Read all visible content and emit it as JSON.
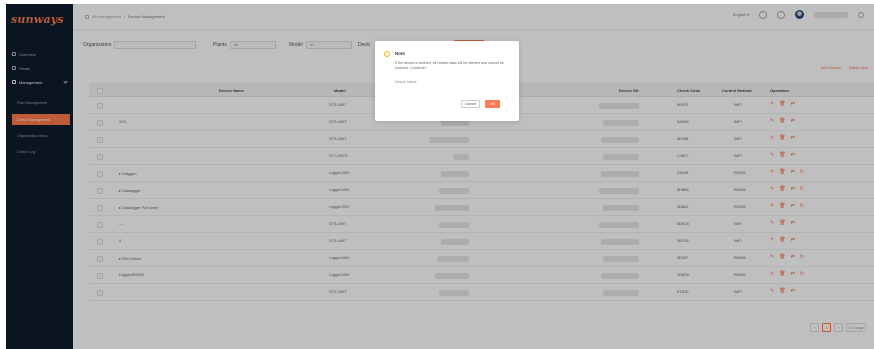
{
  "app": {
    "logo": "sunways"
  },
  "sidebar": {
    "items": [
      {
        "label": "Overview",
        "icon": "dashboard-icon"
      },
      {
        "label": "Plants",
        "icon": "plant-icon"
      },
      {
        "label": "Management",
        "icon": "management-icon"
      }
    ],
    "sub_items": [
      {
        "label": "Plant Management"
      },
      {
        "label": "Device Management"
      },
      {
        "label": "Organization Mana..."
      },
      {
        "label": "Device Log"
      }
    ]
  },
  "topbar": {
    "breadcrumb": [
      "All management",
      "Device Management"
    ],
    "language": "English ▾"
  },
  "filters": {
    "organization_label": "Organization",
    "plants_label": "Plants",
    "plants_value": "All",
    "model_label": "Model",
    "model_value": "All",
    "device_label": "Devic"
  },
  "actions": {
    "add": "Add Device",
    "batch": "Batch dele"
  },
  "table": {
    "headers": [
      "Device Name",
      "Model",
      "Device SN",
      "Check Code",
      "Control Method",
      "Operation"
    ],
    "rows": [
      {
        "name": "",
        "model": "STS-40KT",
        "code": "8E47E",
        "method": "WiFi",
        "ops": 3
      },
      {
        "name": "WTL",
        "model": "STS-40KT",
        "code": "9A8D5",
        "method": "WiFi",
        "ops": 3
      },
      {
        "name": "",
        "model": "STS-40KT",
        "code": "8E40B",
        "method": "WiFi",
        "ops": 3
      },
      {
        "name": "",
        "model": "STT-25KTL",
        "code": "C4B17",
        "method": "WiFi",
        "ops": 3
      },
      {
        "name": "▸ Draggan",
        "model": "Logger1000",
        "code": "41B2B",
        "method": "RS485",
        "ops": 4
      },
      {
        "name": "▸ Datalogger",
        "model": "Logger1000",
        "code": "6H8B5",
        "method": "RS485",
        "ops": 4
      },
      {
        "name": "▸ Datalogger Port Amer",
        "model": "Logger1000",
        "code": "3D8A1",
        "method": "RS485",
        "ops": 4
      },
      {
        "name": "—",
        "model": "STS-40KT",
        "code": "8D8D5",
        "method": "WiFi",
        "ops": 3
      },
      {
        "name": "4",
        "model": "STS-40KT",
        "code": "3B7D5",
        "method": "WiFi",
        "ops": 3
      },
      {
        "name": "▸ Rich Inform",
        "model": "Logger1000",
        "code": "3D287",
        "method": "RS485",
        "ops": 4
      },
      {
        "name": "Logger#R0303",
        "model": "Logger1000",
        "code": "2D6D6",
        "method": "RS485",
        "ops": 4
      },
      {
        "name": "",
        "model": "STS-30KT",
        "code": "E1B2E",
        "method": "WiFi",
        "ops": 3
      }
    ]
  },
  "pager": {
    "current": "1",
    "size": "10 / page"
  },
  "modal": {
    "title": "Note",
    "text": "If the device is deleted, all related data will be deleted and cannot be restored. Continue?",
    "device_name": "Device Name",
    "cancel": "Cancel",
    "ok": "OK"
  }
}
